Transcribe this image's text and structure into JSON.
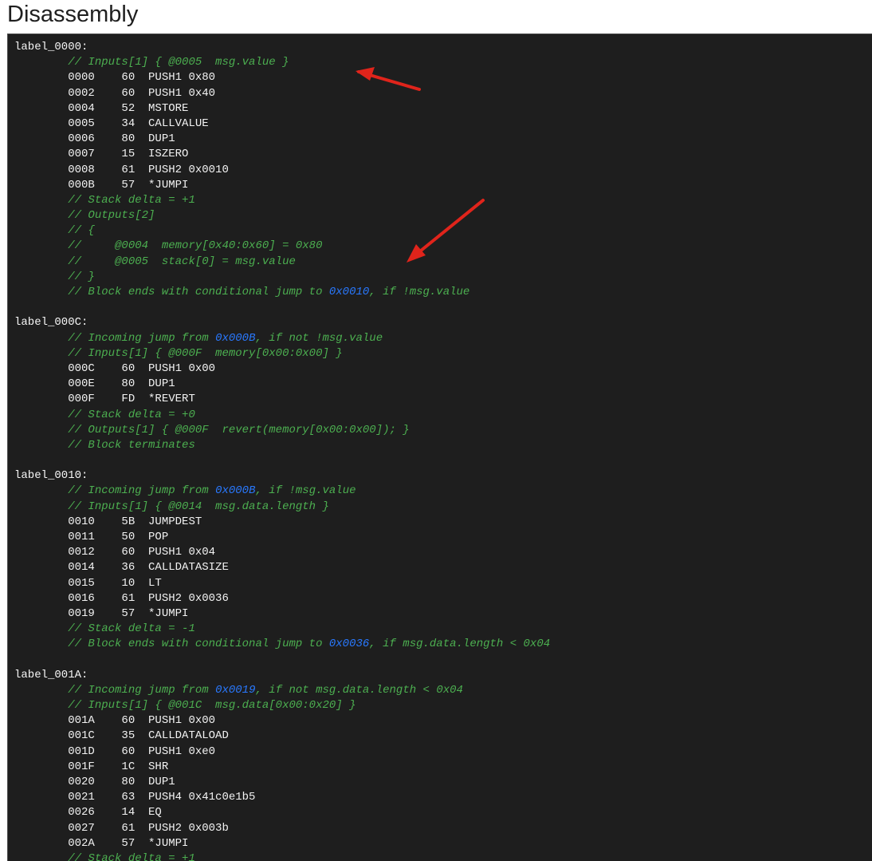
{
  "page": {
    "title": "Disassembly"
  },
  "colors": {
    "panel_bg": "#1e1e1e",
    "text": "#f2f2f2",
    "comment": "#4caf50",
    "jump_link": "#2979ff",
    "annotation_arrow": "#e0241b"
  },
  "lines": [
    {
      "kind": "label",
      "text": "label_0000:"
    },
    {
      "kind": "comment",
      "text": "// Inputs[1] { @0005  msg.value }"
    },
    {
      "kind": "instr",
      "text": "0000    60  PUSH1 0x80"
    },
    {
      "kind": "instr",
      "text": "0002    60  PUSH1 0x40"
    },
    {
      "kind": "instr",
      "text": "0004    52  MSTORE"
    },
    {
      "kind": "instr",
      "text": "0005    34  CALLVALUE"
    },
    {
      "kind": "instr",
      "text": "0006    80  DUP1"
    },
    {
      "kind": "instr",
      "text": "0007    15  ISZERO"
    },
    {
      "kind": "instr",
      "text": "0008    61  PUSH2 0x0010"
    },
    {
      "kind": "instr",
      "text": "000B    57  *JUMPI"
    },
    {
      "kind": "comment",
      "text": "// Stack delta = +1"
    },
    {
      "kind": "comment",
      "text": "// Outputs[2]"
    },
    {
      "kind": "comment",
      "text": "// {"
    },
    {
      "kind": "comment",
      "text": "//     @0004  memory[0x40:0x60] = 0x80"
    },
    {
      "kind": "comment",
      "text": "//     @0005  stack[0] = msg.value"
    },
    {
      "kind": "comment",
      "text": "// }"
    },
    {
      "kind": "comment",
      "text": "// Block ends with conditional jump to ",
      "link": "0x0010",
      "after": ", if !msg.value"
    },
    {
      "kind": "blank",
      "text": ""
    },
    {
      "kind": "label",
      "text": "label_000C:"
    },
    {
      "kind": "comment",
      "text": "// Incoming jump from ",
      "link": "0x000B",
      "after": ", if not !msg.value"
    },
    {
      "kind": "comment",
      "text": "// Inputs[1] { @000F  memory[0x00:0x00] }"
    },
    {
      "kind": "instr",
      "text": "000C    60  PUSH1 0x00"
    },
    {
      "kind": "instr",
      "text": "000E    80  DUP1"
    },
    {
      "kind": "instr",
      "text": "000F    FD  *REVERT"
    },
    {
      "kind": "comment",
      "text": "// Stack delta = +0"
    },
    {
      "kind": "comment",
      "text": "// Outputs[1] { @000F  revert(memory[0x00:0x00]); }"
    },
    {
      "kind": "comment",
      "text": "// Block terminates"
    },
    {
      "kind": "blank",
      "text": ""
    },
    {
      "kind": "label",
      "text": "label_0010:"
    },
    {
      "kind": "comment",
      "text": "// Incoming jump from ",
      "link": "0x000B",
      "after": ", if !msg.value"
    },
    {
      "kind": "comment",
      "text": "// Inputs[1] { @0014  msg.data.length }"
    },
    {
      "kind": "instr",
      "text": "0010    5B  JUMPDEST"
    },
    {
      "kind": "instr",
      "text": "0011    50  POP"
    },
    {
      "kind": "instr",
      "text": "0012    60  PUSH1 0x04"
    },
    {
      "kind": "instr",
      "text": "0014    36  CALLDATASIZE"
    },
    {
      "kind": "instr",
      "text": "0015    10  LT"
    },
    {
      "kind": "instr",
      "text": "0016    61  PUSH2 0x0036"
    },
    {
      "kind": "instr",
      "text": "0019    57  *JUMPI"
    },
    {
      "kind": "comment",
      "text": "// Stack delta = -1"
    },
    {
      "kind": "comment",
      "text": "// Block ends with conditional jump to ",
      "link": "0x0036",
      "after": ", if msg.data.length < 0x04"
    },
    {
      "kind": "blank",
      "text": ""
    },
    {
      "kind": "label",
      "text": "label_001A:"
    },
    {
      "kind": "comment",
      "text": "// Incoming jump from ",
      "link": "0x0019",
      "after": ", if not msg.data.length < 0x04"
    },
    {
      "kind": "comment",
      "text": "// Inputs[1] { @001C  msg.data[0x00:0x20] }"
    },
    {
      "kind": "instr",
      "text": "001A    60  PUSH1 0x00"
    },
    {
      "kind": "instr",
      "text": "001C    35  CALLDATALOAD"
    },
    {
      "kind": "instr",
      "text": "001D    60  PUSH1 0xe0"
    },
    {
      "kind": "instr",
      "text": "001F    1C  SHR"
    },
    {
      "kind": "instr",
      "text": "0020    80  DUP1"
    },
    {
      "kind": "instr",
      "text": "0021    63  PUSH4 0x41c0e1b5"
    },
    {
      "kind": "instr",
      "text": "0026    14  EQ"
    },
    {
      "kind": "instr",
      "text": "0027    61  PUSH2 0x003b"
    },
    {
      "kind": "instr",
      "text": "002A    57  *JUMPI"
    },
    {
      "kind": "comment",
      "text": "// Stack delta = +1"
    }
  ]
}
